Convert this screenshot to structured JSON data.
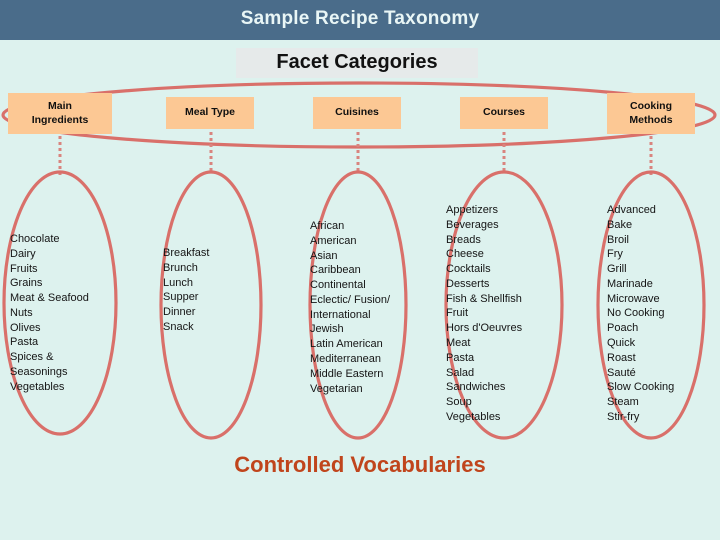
{
  "header": {
    "title": "Sample Recipe Taxonomy",
    "bar_color": "#4a6c8a",
    "text_color": "#e9f6f6"
  },
  "page": {
    "background_color": "#ddf2ee",
    "accent_color": "#d9706a",
    "facet_box_color": "#fcc894",
    "caption_color": "#c0451c"
  },
  "facet_section": {
    "heading": "Facet Categories",
    "heading_band_color": "#e6eaea"
  },
  "caption": {
    "text": "Controlled Vocabularies"
  },
  "facets": [
    {
      "id": "main-ingredients",
      "label": "Main\nIngredients",
      "label_line1": "Main",
      "label_line2": "Ingredients",
      "terms": [
        "Chocolate",
        "Dairy",
        "Fruits",
        "Grains",
        "Meat & Seafood",
        "Nuts",
        "Olives",
        "Pasta",
        "Spices &",
        "Seasonings",
        "Vegetables"
      ]
    },
    {
      "id": "meal-type",
      "label": "Meal Type",
      "label_line1": "Meal Type",
      "label_line2": "",
      "terms": [
        "Breakfast",
        "Brunch",
        "Lunch",
        "Supper",
        "Dinner",
        "Snack"
      ]
    },
    {
      "id": "cuisines",
      "label": "Cuisines",
      "label_line1": "Cuisines",
      "label_line2": "",
      "terms": [
        "African",
        "American",
        "Asian",
        "Caribbean",
        "Continental",
        "Eclectic/ Fusion/",
        "International",
        "Jewish",
        "Latin American",
        "Mediterranean",
        "Middle Eastern",
        "Vegetarian"
      ]
    },
    {
      "id": "courses",
      "label": "Courses",
      "label_line1": "Courses",
      "label_line2": "",
      "terms": [
        "Appetizers",
        "Beverages",
        "Breads",
        "Cheese",
        "Cocktails",
        "Desserts",
        "Fish & Shellfish",
        "Fruit",
        "Hors d'Oeuvres",
        "Meat",
        "Pasta",
        "Salad",
        "Sandwiches",
        "Soup",
        "Vegetables"
      ]
    },
    {
      "id": "cooking-methods",
      "label": "Cooking\nMethods",
      "label_line1": "Cooking",
      "label_line2": "Methods",
      "terms": [
        "Advanced",
        "Bake",
        "Broil",
        "Fry",
        "Grill",
        "Marinade",
        "Microwave",
        "No Cooking",
        "Poach",
        "Quick",
        "Roast",
        "Sauté",
        "Slow Cooking",
        "Steam",
        "Stir-fry"
      ]
    }
  ]
}
